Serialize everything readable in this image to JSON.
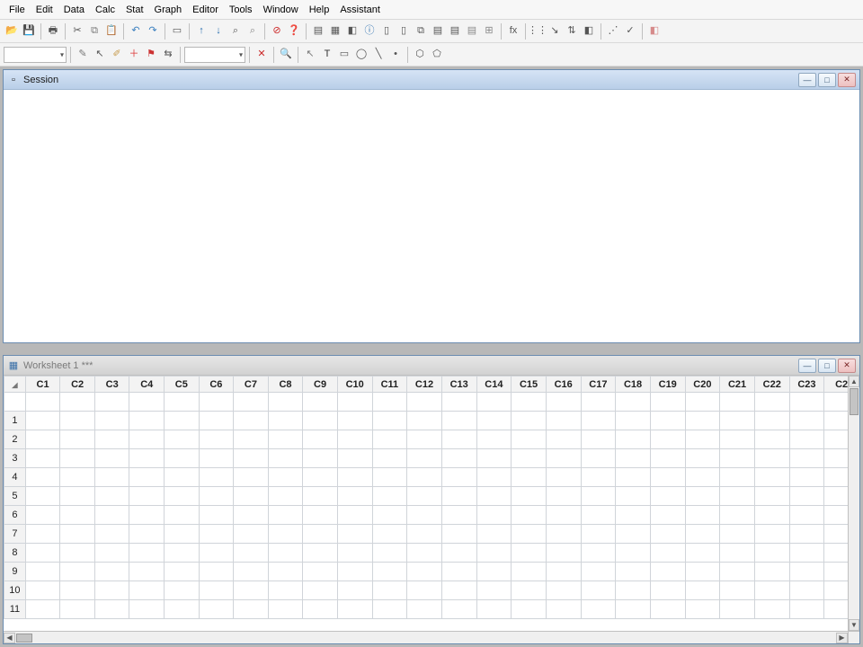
{
  "menu": [
    "File",
    "Edit",
    "Data",
    "Calc",
    "Stat",
    "Graph",
    "Editor",
    "Tools",
    "Window",
    "Help",
    "Assistant"
  ],
  "toolbar1_groups": [
    [
      {
        "name": "open-icon",
        "glyph": "📂",
        "color": "#d99a2b"
      },
      {
        "name": "save-icon",
        "glyph": "💾",
        "color": "#6a5acd"
      }
    ],
    [
      {
        "name": "print-icon",
        "glyph": "🖶",
        "color": "#555"
      }
    ],
    [
      {
        "name": "cut-icon",
        "glyph": "✂",
        "color": "#555"
      },
      {
        "name": "copy-icon",
        "glyph": "⧉",
        "color": "#777"
      },
      {
        "name": "paste-icon",
        "glyph": "📋",
        "color": "#c79a4a"
      }
    ],
    [
      {
        "name": "undo-icon",
        "glyph": "↶",
        "color": "#3a7fbf"
      },
      {
        "name": "redo-icon",
        "glyph": "↷",
        "color": "#3a7fbf"
      }
    ],
    [
      {
        "name": "next-cmd-icon",
        "glyph": "▭",
        "color": "#555"
      }
    ],
    [
      {
        "name": "arrow-up-icon",
        "glyph": "↑",
        "color": "#2a6fb0"
      },
      {
        "name": "arrow-down-icon",
        "glyph": "↓",
        "color": "#2a6fb0"
      },
      {
        "name": "find-icon",
        "glyph": "⌕",
        "color": "#555"
      },
      {
        "name": "find-next-icon",
        "glyph": "⌕",
        "color": "#888"
      }
    ],
    [
      {
        "name": "cancel-icon",
        "glyph": "⊘",
        "color": "#cc2b2b"
      },
      {
        "name": "help-icon",
        "glyph": "❓",
        "color": "#2a6fb0"
      }
    ],
    [
      {
        "name": "show-session-icon",
        "glyph": "▤",
        "color": "#555"
      },
      {
        "name": "show-worksheets-icon",
        "glyph": "▦",
        "color": "#555"
      },
      {
        "name": "show-graphs-icon",
        "glyph": "◧",
        "color": "#555"
      },
      {
        "name": "show-info-icon",
        "glyph": "ⓘ",
        "color": "#2a6fb0"
      },
      {
        "name": "show-history-icon",
        "glyph": "▯",
        "color": "#555"
      },
      {
        "name": "show-reportpad-icon",
        "glyph": "▯",
        "color": "#555"
      },
      {
        "name": "show-related-icon",
        "glyph": "⧉",
        "color": "#555"
      },
      {
        "name": "project-manager-icon",
        "glyph": "▤",
        "color": "#555"
      },
      {
        "name": "toolbars-icon",
        "glyph": "▤",
        "color": "#555"
      },
      {
        "name": "status-bar-icon",
        "glyph": "▤",
        "color": "#888"
      },
      {
        "name": "close-all-icon",
        "glyph": "⊞",
        "color": "#888"
      }
    ],
    [
      {
        "name": "fx-icon",
        "glyph": "fx",
        "color": "#555"
      }
    ],
    [
      {
        "name": "stat-desc-icon",
        "glyph": "⋮⋮",
        "color": "#555"
      },
      {
        "name": "stat-regress-icon",
        "glyph": "↘",
        "color": "#555"
      },
      {
        "name": "stat-anova-icon",
        "glyph": "⇅",
        "color": "#555"
      },
      {
        "name": "stat-doe-icon",
        "glyph": "◧",
        "color": "#555"
      }
    ],
    [
      {
        "name": "chart-scatter-icon",
        "glyph": "⋰",
        "color": "#555"
      },
      {
        "name": "chart-line-icon",
        "glyph": "✓",
        "color": "#555"
      }
    ],
    [
      {
        "name": "eraser-icon",
        "glyph": "◧",
        "color": "#d68a8a"
      }
    ]
  ],
  "toolbar2": {
    "combo1_width": 70,
    "combo2_width": 68,
    "groups": [
      [
        {
          "name": "edit-mode-icon",
          "glyph": "✎",
          "color": "#777"
        },
        {
          "name": "select-icon",
          "glyph": "↖",
          "color": "#555"
        },
        {
          "name": "brush-icon",
          "glyph": "✐",
          "color": "#c79a4a"
        },
        {
          "name": "add-point-icon",
          "glyph": "＋",
          "color": "#d33"
        },
        {
          "name": "flag-icon",
          "glyph": "⚑",
          "color": "#c33"
        },
        {
          "name": "toggle-icon",
          "glyph": "⇆",
          "color": "#555"
        }
      ],
      [
        {
          "name": "delete-icon",
          "glyph": "✕",
          "color": "#cc2b2b"
        }
      ],
      [
        {
          "name": "zoom-icon",
          "glyph": "🔍",
          "color": "#555"
        }
      ],
      [
        {
          "name": "pointer-icon",
          "glyph": "↖",
          "color": "#777"
        },
        {
          "name": "text-tool-icon",
          "glyph": "T",
          "color": "#333"
        },
        {
          "name": "rect-tool-icon",
          "glyph": "▭",
          "color": "#555"
        },
        {
          "name": "circle-tool-icon",
          "glyph": "◯",
          "color": "#555"
        },
        {
          "name": "line-tool-icon",
          "glyph": "╲",
          "color": "#555"
        },
        {
          "name": "marker-tool-icon",
          "glyph": "•",
          "color": "#555"
        }
      ],
      [
        {
          "name": "polyline-tool-icon",
          "glyph": "⬡",
          "color": "#555"
        },
        {
          "name": "polygon-tool-icon",
          "glyph": "⬠",
          "color": "#555"
        }
      ]
    ]
  },
  "session": {
    "title": "Session"
  },
  "worksheet": {
    "title": "Worksheet 1 ***",
    "columns": [
      "C1",
      "C2",
      "C3",
      "C4",
      "C5",
      "C6",
      "C7",
      "C8",
      "C9",
      "C10",
      "C11",
      "C12",
      "C13",
      "C14",
      "C15",
      "C16",
      "C17",
      "C18",
      "C19",
      "C20",
      "C21",
      "C22",
      "C23"
    ],
    "partial_column": "C2",
    "rows": [
      1,
      2,
      3,
      4,
      5,
      6,
      7,
      8,
      9,
      10,
      11
    ]
  }
}
